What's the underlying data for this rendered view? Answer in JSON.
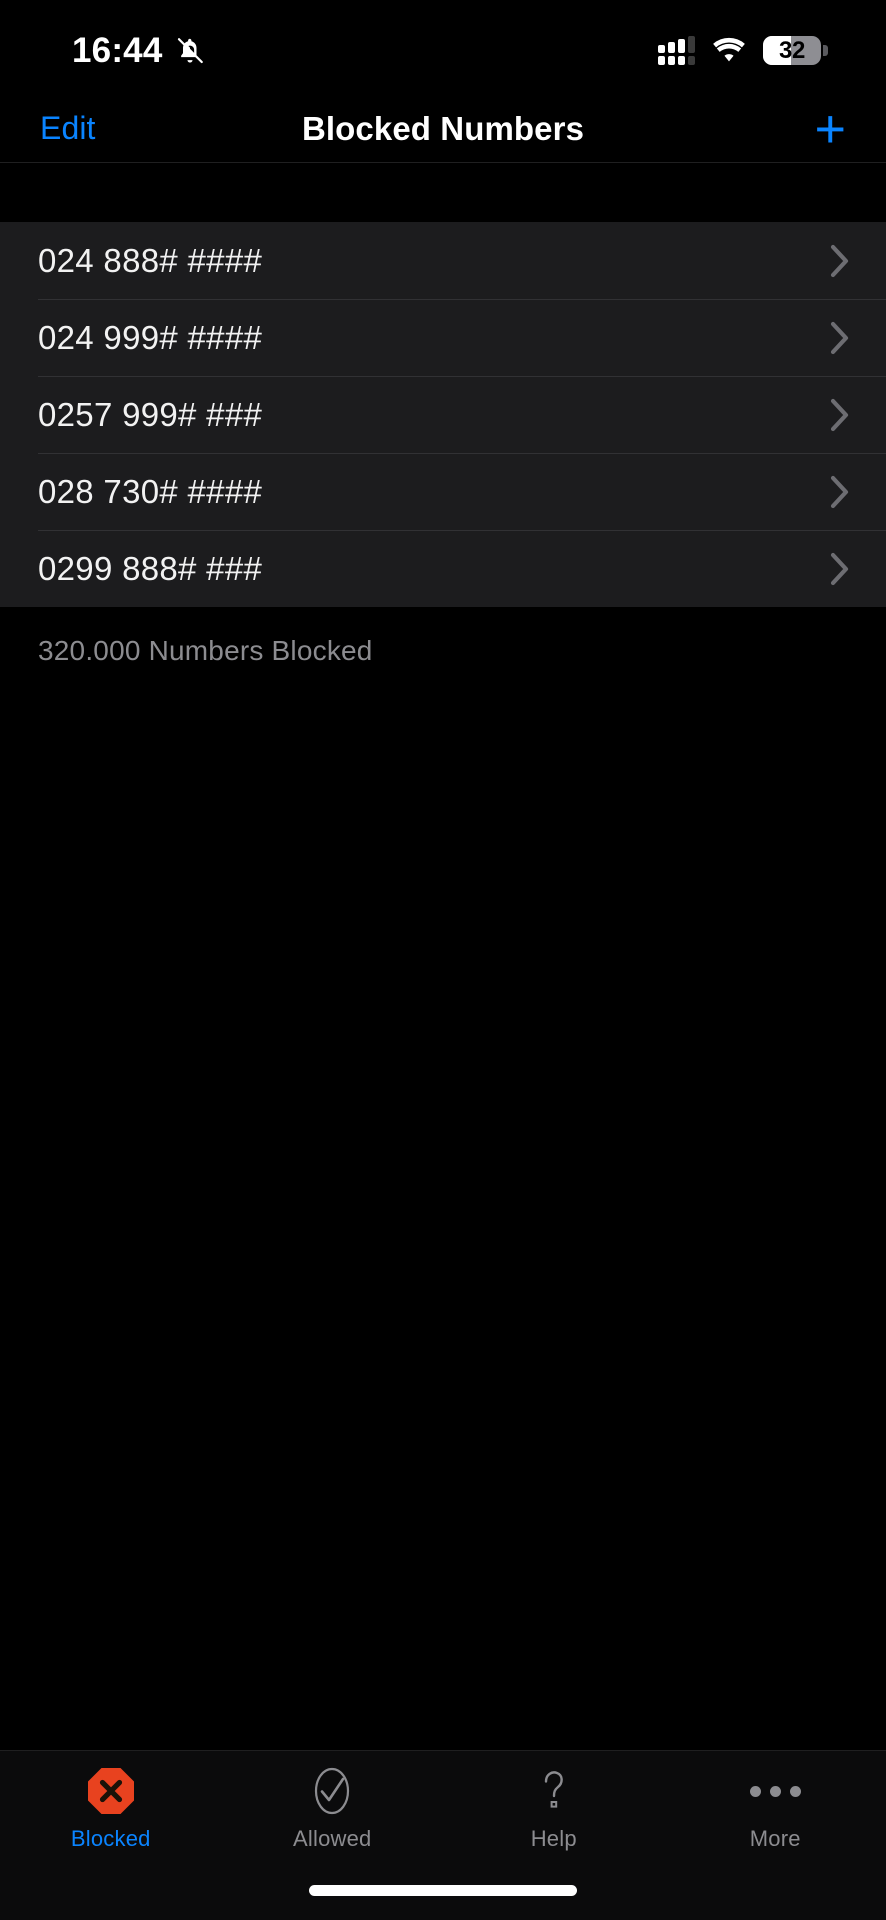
{
  "status_bar": {
    "time": "16:44",
    "silent_icon": "bell-slash-icon",
    "signal_icon": "cellular-signal-dual-icon",
    "wifi_icon": "wifi-icon",
    "battery_percent": "32",
    "battery_icon": "battery-icon"
  },
  "nav_bar": {
    "edit_label": "Edit",
    "title": "Blocked Numbers",
    "add_label": "+"
  },
  "list": {
    "rows": [
      {
        "number": "024 888# ####"
      },
      {
        "number": "024 999# ####"
      },
      {
        "number": "0257 999# ###"
      },
      {
        "number": "028 730# ####"
      },
      {
        "number": "0299 888# ###"
      }
    ],
    "footer": "320.000 Numbers Blocked"
  },
  "tab_bar": {
    "items": [
      {
        "label": "Blocked",
        "icon": "blocked-octagon-x-icon",
        "active": true
      },
      {
        "label": "Allowed",
        "icon": "check-circle-icon",
        "active": false
      },
      {
        "label": "Help",
        "icon": "question-mark-icon",
        "active": false
      },
      {
        "label": "More",
        "icon": "more-dots-icon",
        "active": false
      }
    ]
  },
  "colors": {
    "accent_blue": "#0A84FF",
    "blocked_orange": "#E8421F",
    "row_background": "#1C1C1E",
    "page_background": "#000000",
    "secondary_text": "#8C8C90"
  }
}
